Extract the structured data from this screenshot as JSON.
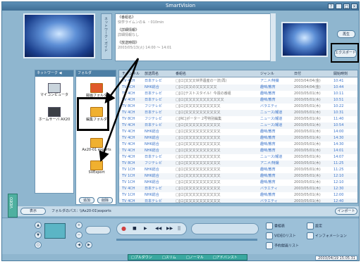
{
  "window": {
    "title": "SmartVision",
    "buttons": [
      "?",
      "_",
      "□",
      "×"
    ]
  },
  "preview_left": {
    "logo": ""
  },
  "side_tab": {
    "label": "ネットワーク・ガイド"
  },
  "info": {
    "title_label": "《番組名》",
    "title_value": "快学ライムンの＆ ・010min",
    "detail_label": "《詳細情報》",
    "detail_value": "詳細情報なし",
    "air_label": "《放送時間》",
    "air_value": "2003/05/13(火) 14:00 〜 14:01"
  },
  "right_panel": {
    "play_label": "再生",
    "export_label": "エクスポート"
  },
  "network": {
    "header": "ネットワーク ◀",
    "items": [
      {
        "label": "マイコンピュータ"
      },
      {
        "label": "ホームサーバ AX20"
      }
    ]
  },
  "folder": {
    "header": "フォルダ",
    "items": [
      {
        "label": "録画フォルダ"
      },
      {
        "label": "編集フォルダ"
      },
      {
        "label": "Ax20-01 exports"
      },
      {
        "label": "SVExport"
      }
    ],
    "add_label": "追加",
    "delete_label": "削除"
  },
  "list": {
    "columns": [
      "チャンネル",
      "放送局名",
      "番組名",
      "ジャンル",
      "日付",
      "開始時刻"
    ],
    "rows": [
      [
        "TV 4CH",
        "日本テレビ",
        "□[ロ]又又又世界遺産の一流(再)",
        "アニメ/特撮",
        "2003/04/04(金)",
        "10:41"
      ],
      [
        "TV 4CH",
        "NHK総合",
        "□[ロ]又又の又又又又又又",
        "趣味/教育",
        "2003/04/04(金)",
        "10:44"
      ],
      [
        "TV 4CH",
        "日本テレビ",
        "□[ロ]テストスタイル！今週の番組",
        "趣味/教育",
        "2003/05/01(木)",
        "10:11"
      ],
      [
        "TV 4CH",
        "日本テレビ",
        "□[ロ]又又又又又又又又又又又",
        "趣味/教育",
        "2003/05/01(木)",
        "10:51"
      ],
      [
        "TV 8CH",
        "フジテレビ",
        "□[ロ]又又又又又又又又又又",
        "バラエティ",
        "2003/05/01(木)",
        "10:22"
      ],
      [
        "TV 4CH",
        "日本テレビ",
        "□[ロ]又又又又又又又又又又",
        "ニュース/報道",
        "2003/05/01(木)",
        "10:31"
      ],
      [
        "TV 8CH",
        "フジテレビ",
        "□[RC]ポーター 2号特別編集",
        "ニュース/報道",
        "2003/05/01(木)",
        "11:40"
      ],
      [
        "TV 4CH",
        "日本テレビ",
        "□[ロ]又又又又又又又又又又",
        "ニュース/報道",
        "2003/05/01(木)",
        "10:54"
      ],
      [
        "TV 4CH",
        "NHK総合",
        "□[ロ]又又又又又又又又又又",
        "趣味/教育",
        "2003/05/01(木)",
        "14:00"
      ],
      [
        "TV 4CH",
        "NHK総合",
        "□[ロ]又又又又又又又又又又",
        "趣味/教育",
        "2003/05/01(木)",
        "14:30"
      ],
      [
        "TV 4CH",
        "NHK総合",
        "□[ロ]又又又又又又又又又又",
        "趣味/教育",
        "2003/05/01(木)",
        "14:30"
      ],
      [
        "TV 4CH",
        "NHK総合",
        "□[ロ]又又又又又又又又又又",
        "趣味/教育",
        "2003/05/01(木)",
        "14:01"
      ],
      [
        "TV 4CH",
        "日本テレビ",
        "□[ロ]又又又又又又又又又又",
        "ニュース/報道",
        "2003/05/01(木)",
        "14:07"
      ],
      [
        "TV 8CH",
        "フジテレビ",
        "□[ロ]又又又又又又又又又又",
        "アニメ/特撮",
        "2003/05/01(木)",
        "11:25"
      ],
      [
        "TV 1CH",
        "NHK総合",
        "□[ロ]又又又又又又又又又又",
        "趣味/教育",
        "2003/05/01(木)",
        "11:25"
      ],
      [
        "TV 1CH",
        "NHK総合",
        "□[ロ]又又又又又又又又又又",
        "趣味/教育",
        "2003/05/01(木)",
        "12:10"
      ],
      [
        "TV 1CH",
        "NHK総合",
        "□[ロ]又又又又又又又又又又",
        "趣味/教育",
        "2003/05/01(木)",
        "12:10"
      ],
      [
        "TV 4CH",
        "日本テレビ",
        "□[ロ]又又又又又又又又又又",
        "バラエティ",
        "2003/05/01(木)",
        "12:30"
      ],
      [
        "TV 1CH",
        "NHK総合",
        "□[ロ]又又又又又又又又又又",
        "趣味/教育",
        "2003/05/01(木)",
        "12:00"
      ],
      [
        "TV 4CH",
        "日本テレビ",
        "□[ロ]又又又又又又又又又又",
        "バラエティ",
        "2003/05/01(木)",
        "12:40"
      ]
    ]
  },
  "path_bar": {
    "display_label": "表示",
    "path": "フォルダのパス：\\\\Ax20-01\\exports",
    "import_label": "インポート"
  },
  "controls": {
    "right_buttons": [
      {
        "label": "番組表"
      },
      {
        "label": "設定"
      },
      {
        "label": "VIDEOリスト"
      },
      {
        "label": "インフォメーション"
      },
      {
        "label": "予約録画リスト"
      }
    ],
    "transport": [
      "●",
      "■",
      "▶",
      "◀◀",
      "▶▶",
      "||"
    ],
    "modes": [
      "□プルダウン",
      "□スリム",
      "□ノーマル",
      "□アドバンスト"
    ],
    "video_tab": "VIDEO",
    "clock": "2003/04/19 15:05:31"
  }
}
